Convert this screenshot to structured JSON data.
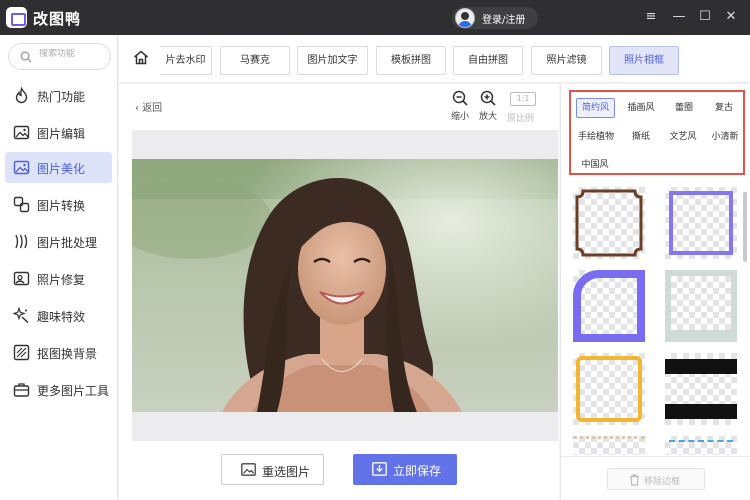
{
  "app": {
    "name": "改图鸭",
    "login_label": "登录/注册"
  },
  "window_controls": {
    "menu": "≡",
    "minimize": "—",
    "maximize": "☐",
    "close": "✕"
  },
  "sidebar": {
    "search_placeholder": "搜索功能",
    "items": [
      {
        "label": "热门功能",
        "icon": "flame-icon"
      },
      {
        "label": "图片编辑",
        "icon": "image-edit-icon"
      },
      {
        "label": "图片美化",
        "icon": "image-beautify-icon"
      },
      {
        "label": "图片转换",
        "icon": "convert-icon"
      },
      {
        "label": "图片批处理",
        "icon": "batch-icon"
      },
      {
        "label": "照片修复",
        "icon": "photo-repair-icon"
      },
      {
        "label": "趣味特效",
        "icon": "sparkle-icon"
      },
      {
        "label": "抠图换背景",
        "icon": "cutout-icon"
      },
      {
        "label": "更多图片工具",
        "icon": "toolbox-icon"
      }
    ],
    "active_index": 2
  },
  "toolbar": {
    "tabs": [
      "片去水印",
      "马赛克",
      "图片加文字",
      "模板拼图",
      "自由拼图",
      "照片滤镜",
      "照片相框"
    ],
    "active_index": 6
  },
  "canvas": {
    "back_label": "返回",
    "zoom_out_label": "缩小",
    "zoom_in_label": "放大",
    "ratio_box": "1:1",
    "ratio_label": "原比例",
    "reselect_label": "重选图片",
    "save_label": "立即保存"
  },
  "frame_styles": {
    "options": [
      "简约风",
      "插画风",
      "蕾圈",
      "复古",
      "手绘植物",
      "撕纸",
      "文艺风",
      "小清新",
      "中国风"
    ],
    "active_index": 0
  },
  "remove_frame_label": "移除边框",
  "colors": {
    "accent": "#6272e9",
    "title_bar": "#2f2f31",
    "highlight_box": "#e0534c"
  }
}
